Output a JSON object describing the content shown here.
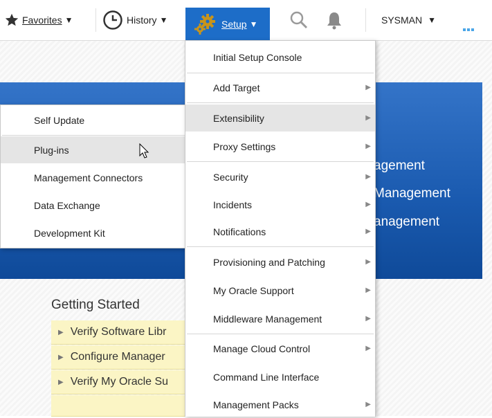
{
  "toolbar": {
    "favorites_label": "Favorites",
    "history_label": "History",
    "setup_label": "Setup",
    "user_label": "SYSMAN",
    "caret": "▼"
  },
  "setup_menu": {
    "items": [
      {
        "label": "Initial Setup Console",
        "has_submenu": false
      },
      {
        "label": "Add Target",
        "has_submenu": true
      },
      {
        "label": "Extensibility",
        "has_submenu": true,
        "active": true
      },
      {
        "label": "Proxy Settings",
        "has_submenu": true
      },
      {
        "label": "Security",
        "has_submenu": true
      },
      {
        "label": "Incidents",
        "has_submenu": true
      },
      {
        "label": "Notifications",
        "has_submenu": true
      },
      {
        "label": "Provisioning and Patching",
        "has_submenu": true
      },
      {
        "label": "My Oracle Support",
        "has_submenu": true
      },
      {
        "label": "Middleware Management",
        "has_submenu": true
      },
      {
        "label": "Manage Cloud Control",
        "has_submenu": true
      },
      {
        "label": "Command Line Interface",
        "has_submenu": false
      },
      {
        "label": "Management Packs",
        "has_submenu": true
      }
    ]
  },
  "extensibility_menu": {
    "items": [
      {
        "label": "Self Update"
      },
      {
        "label": "Plug-ins",
        "hovered": true
      },
      {
        "label": "Management Connectors"
      },
      {
        "label": "Data Exchange"
      },
      {
        "label": "Development Kit"
      }
    ]
  },
  "banner": {
    "lines": [
      "agement",
      "Management",
      "anagement"
    ]
  },
  "getting_started": {
    "title": "Getting Started",
    "links": [
      "Verify Software Libr",
      "Configure Manager",
      "Verify My Oracle Su"
    ]
  },
  "colors": {
    "setup_button": "#1d6dc8",
    "banner": "#1a5aaf",
    "link_background": "#fbf5c5",
    "menu_active": "#e5e5e5"
  }
}
